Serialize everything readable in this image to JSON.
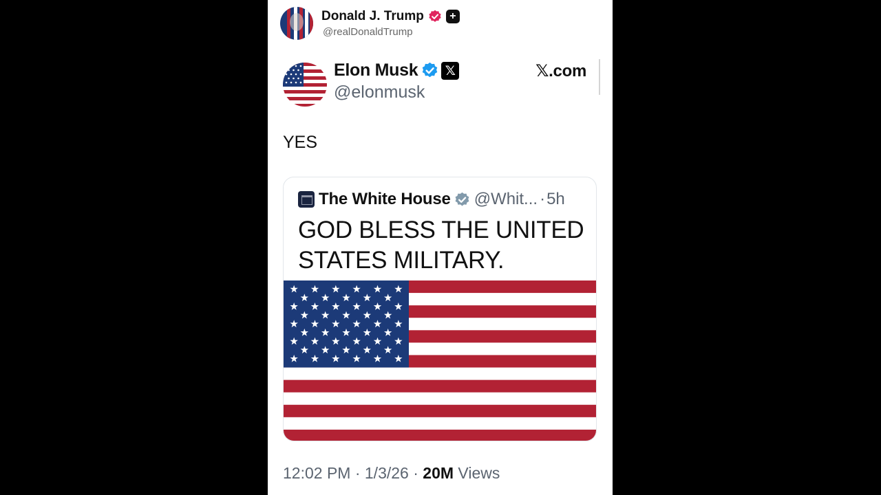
{
  "outer_post": {
    "display_name": "Donald J. Trump",
    "handle": "@realDonaldTrump",
    "plus_glyph": "+"
  },
  "embedded_post": {
    "display_name": "Elon Musk",
    "handle": "@elonmusk",
    "x_logo_glyph": "𝕏",
    "brand": "𝕏.com",
    "text": "YES",
    "timestamp": "12:02 PM · 1/3/26 · ",
    "views_count": "20M",
    "views_label": " Views"
  },
  "quoted_post": {
    "display_name": "The White House",
    "handle": "@Whit...",
    "separator": "·",
    "age": "5h",
    "text": "GOD BLESS THE UNITED STATES MILITARY."
  },
  "colors": {
    "page_background": "#000000",
    "verified_pink": "#e0245e",
    "verified_blue": "#1d9bf0",
    "verified_gray": "#829aab",
    "flag_red": "#b22234",
    "flag_blue": "#1c3a78"
  },
  "icons": {
    "outer_avatar": "flag-portrait-avatar",
    "outer_badge": "verified-badge-icon",
    "x_avatar": "us-flag-avatar",
    "x_badge": "verified-badge-icon",
    "quoted_logo": "white-house-logo",
    "quoted_badge": "government-badge-icon"
  }
}
